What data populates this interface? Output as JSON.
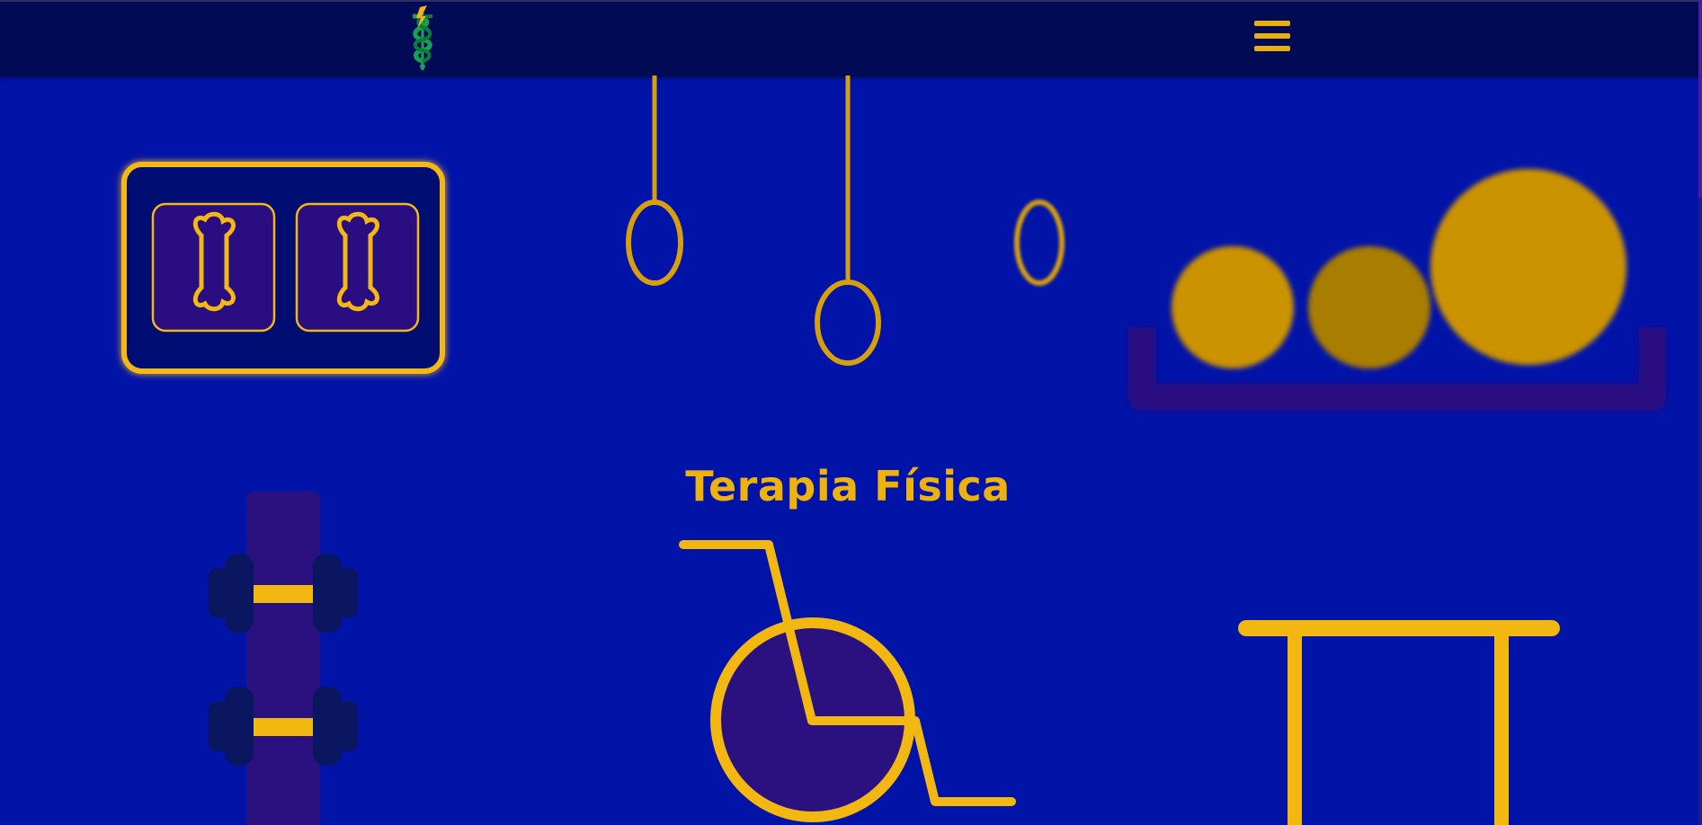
{
  "header": {
    "logo": "caduceus-logo",
    "menu_icon": "hamburger-menu-icon"
  },
  "main": {
    "title": "Terapia Física"
  },
  "colors": {
    "background": "#0213a8",
    "header": "#000a55",
    "accent": "#eeb20f",
    "purple": "#2b1180",
    "navy": "#0a1660"
  },
  "illustrations": [
    "bone-panel-icon",
    "gymnastic-rings-icon",
    "therapy-balls-icon",
    "dumbbell-rack-icon",
    "wheelchair-icon",
    "table-icon"
  ]
}
